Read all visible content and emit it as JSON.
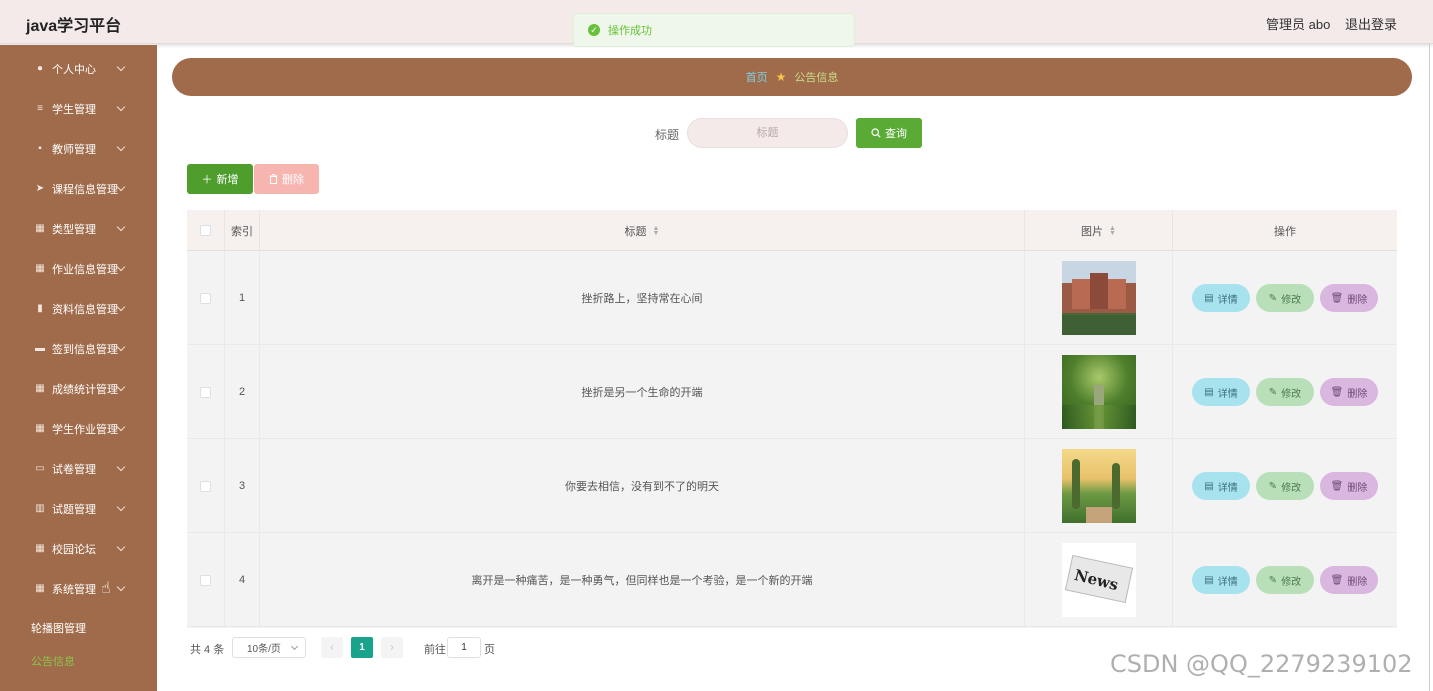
{
  "header": {
    "brand": "java学习平台",
    "admin": "管理员 abo",
    "logout": "退出登录"
  },
  "toast": {
    "text": "操作成功"
  },
  "sidebar": {
    "items": [
      {
        "label": "个人中心",
        "icon": "user-icon"
      },
      {
        "label": "学生管理",
        "icon": "list-icon"
      },
      {
        "label": "教师管理",
        "icon": "tablet-icon"
      },
      {
        "label": "课程信息管理",
        "icon": "send-icon"
      },
      {
        "label": "类型管理",
        "icon": "grid-icon"
      },
      {
        "label": "作业信息管理",
        "icon": "grid-icon"
      },
      {
        "label": "资料信息管理",
        "icon": "clipboard-icon"
      },
      {
        "label": "签到信息管理",
        "icon": "ticket-icon"
      },
      {
        "label": "成绩统计管理",
        "icon": "grid-icon"
      },
      {
        "label": "学生作业管理",
        "icon": "grid-icon"
      },
      {
        "label": "试卷管理",
        "icon": "monitor-icon"
      },
      {
        "label": "试题管理",
        "icon": "chart-icon"
      },
      {
        "label": "校园论坛",
        "icon": "grid-icon"
      },
      {
        "label": "系统管理",
        "icon": "grid-icon"
      }
    ],
    "sub_items": [
      {
        "label": "轮播图管理"
      },
      {
        "label": "公告信息"
      }
    ]
  },
  "breadcrumb": {
    "home": "首页",
    "current": "公告信息"
  },
  "search": {
    "label": "标题",
    "placeholder": "标题",
    "button": "查询"
  },
  "toolbar": {
    "add": "新增",
    "delete": "删除"
  },
  "table": {
    "headers": {
      "index": "索引",
      "title": "标题",
      "image": "图片",
      "actions": "操作"
    },
    "rows": [
      {
        "index": "1",
        "title": "挫折路上，坚持常在心间",
        "image": "campus-building-image"
      },
      {
        "index": "2",
        "title": "挫折是另一个生命的开端",
        "image": "tree-path-image"
      },
      {
        "index": "3",
        "title": "你要去相信，没有到不了的明天",
        "image": "sunset-road-image"
      },
      {
        "index": "4",
        "title": "离开是一种痛苦，是一种勇气，但同样也是一个考验，是一个新的开端",
        "image": "news-image"
      }
    ],
    "row_actions": {
      "detail": "详情",
      "edit": "修改",
      "delete": "删除"
    }
  },
  "pagination": {
    "total": "共 4 条",
    "page_size": "10条/页",
    "current_page": "1",
    "goto_label": "前往",
    "goto_value": "1",
    "page_suffix": "页"
  },
  "watermark": "CSDN @QQ_2279239102",
  "colors": {
    "sidebar": "#a06b4a",
    "accent_green": "#5aab36",
    "header_bg": "#f4eaea"
  }
}
